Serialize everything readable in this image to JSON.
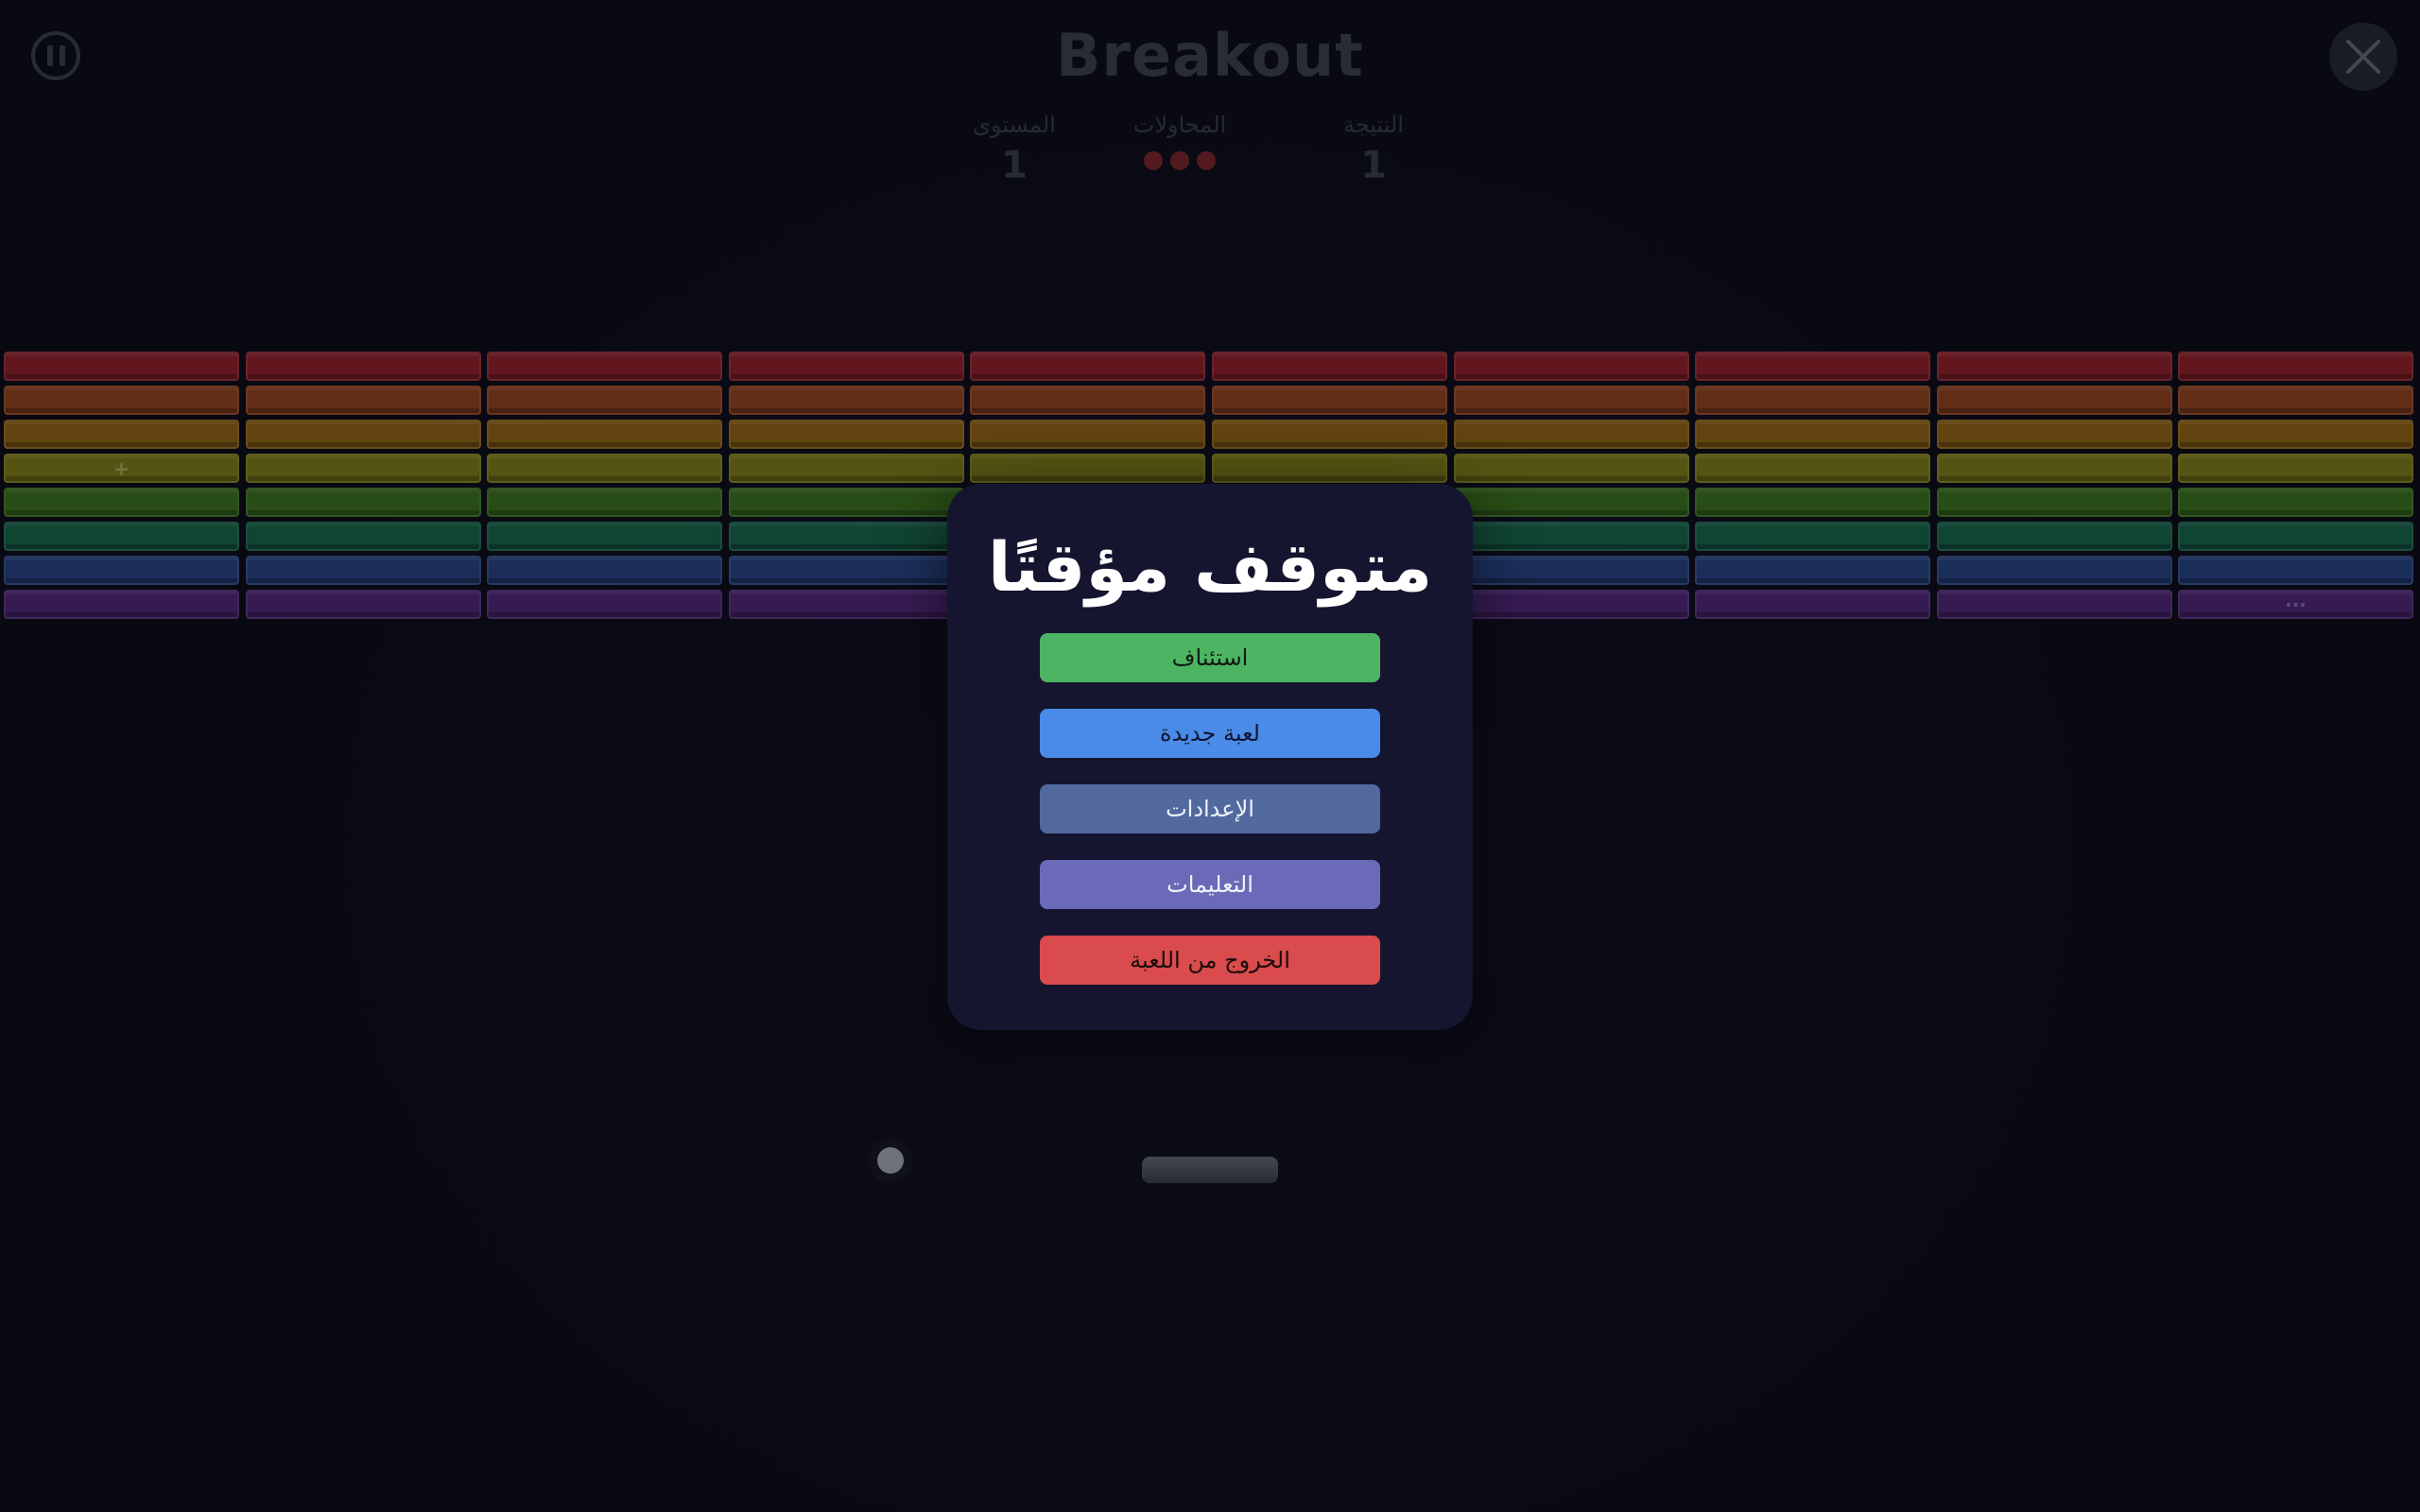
{
  "game": {
    "title": "Breakout",
    "pause_icon": "pause-icon",
    "close_icon": "close-icon"
  },
  "stats": {
    "score_label": "النتيجة",
    "score_value": "1",
    "lives_label": "المحاولات",
    "lives_count": 3,
    "lives_color": "#5a1d22",
    "level_label": "المستوى",
    "level_value": "1"
  },
  "bricks": {
    "columns": 10,
    "rows": [
      {
        "color": "#6b1a22"
      },
      {
        "color": "#6b3219"
      },
      {
        "color": "#6a4a12"
      },
      {
        "color": "#5e5c14"
      },
      {
        "color": "#2c5418"
      },
      {
        "color": "#124a38"
      },
      {
        "color": "#1e3262"
      },
      {
        "color": "#3b1e5a"
      }
    ],
    "marks": [
      {
        "row": 3,
        "col": 0,
        "symbol": "+"
      },
      {
        "row": 7,
        "col": 9,
        "symbol": "···"
      }
    ]
  },
  "pause_menu": {
    "title": "متوقف مؤقتًا",
    "buttons": [
      {
        "label": "استئناف",
        "bg": "#4cb462",
        "fg": "#0f1a12",
        "name": "resume-button"
      },
      {
        "label": "لعبة جديدة",
        "bg": "#4a8be8",
        "fg": "#0d1730",
        "name": "new-game-button"
      },
      {
        "label": "الإعدادات",
        "bg": "#51699e",
        "fg": "#eef1f8",
        "name": "settings-button"
      },
      {
        "label": "التعليمات",
        "bg": "#6a6ab8",
        "fg": "#f1f1fb",
        "name": "instructions-button"
      },
      {
        "label": "الخروج من اللعبة",
        "bg": "#d94b4c",
        "fg": "#1c0c0c",
        "name": "exit-game-button"
      }
    ]
  }
}
